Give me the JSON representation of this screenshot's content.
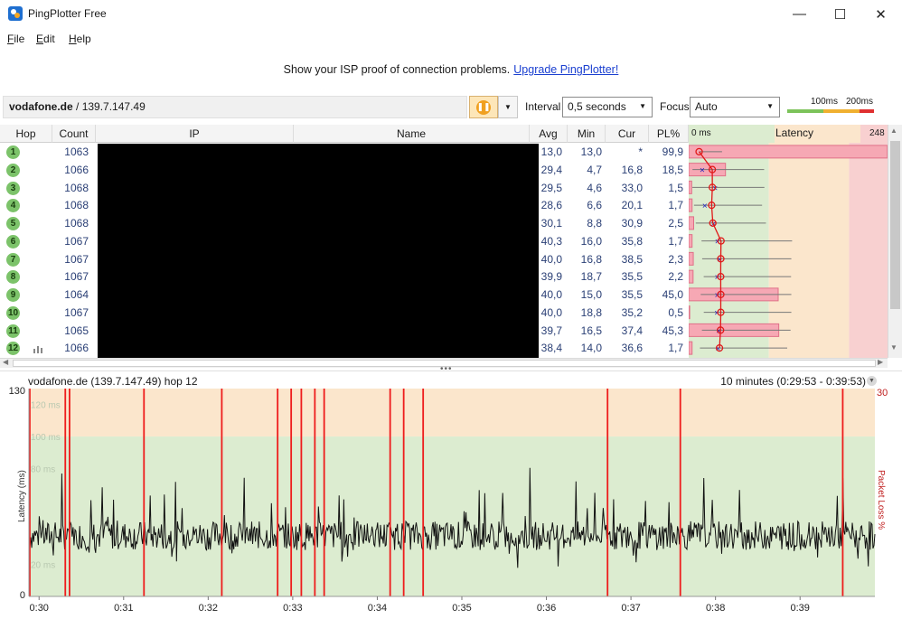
{
  "window": {
    "title": "PingPlotter Free",
    "minimize": "—",
    "maximize": "☐",
    "close": "✕"
  },
  "menu": [
    {
      "label": "File",
      "ul": "F",
      "rest": "ile"
    },
    {
      "label": "Edit",
      "ul": "E",
      "rest": "dit"
    },
    {
      "label": "Help",
      "ul": "H",
      "rest": "elp"
    }
  ],
  "promo": {
    "text": "Show your ISP proof of connection problems.",
    "link": "Upgrade PingPlotter!"
  },
  "toolbar": {
    "target_host": "vodafone.de",
    "target_ip": " / 139.7.147.49",
    "interval_label": "Interval",
    "interval_value": "0,5 seconds",
    "focus_label": "Focus",
    "focus_value": "Auto",
    "scale_100": "100ms",
    "scale_200": "200ms"
  },
  "table": {
    "headers": {
      "hop": "Hop",
      "count": "Count",
      "ip": "IP",
      "name": "Name",
      "avg": "Avg",
      "min": "Min",
      "cur": "Cur",
      "pl": "PL%",
      "latency": "Latency",
      "latency_start": "0 ms",
      "latency_end": "248"
    },
    "rows": [
      {
        "hop": "1",
        "count": "1063",
        "avg": "13,0",
        "min": "13,0",
        "cur": "*",
        "pl": "99,9"
      },
      {
        "hop": "2",
        "count": "1066",
        "avg": "29,4",
        "min": "4,7",
        "cur": "16,8",
        "pl": "18,5"
      },
      {
        "hop": "3",
        "count": "1068",
        "avg": "29,5",
        "min": "4,6",
        "cur": "33,0",
        "pl": "1,5"
      },
      {
        "hop": "4",
        "count": "1068",
        "avg": "28,6",
        "min": "6,6",
        "cur": "20,1",
        "pl": "1,7"
      },
      {
        "hop": "5",
        "count": "1068",
        "avg": "30,1",
        "min": "8,8",
        "cur": "30,9",
        "pl": "2,5"
      },
      {
        "hop": "6",
        "count": "1067",
        "avg": "40,3",
        "min": "16,0",
        "cur": "35,8",
        "pl": "1,7"
      },
      {
        "hop": "7",
        "count": "1067",
        "avg": "40,0",
        "min": "16,8",
        "cur": "38,5",
        "pl": "2,3"
      },
      {
        "hop": "8",
        "count": "1067",
        "avg": "39,9",
        "min": "18,7",
        "cur": "35,5",
        "pl": "2,2"
      },
      {
        "hop": "9",
        "count": "1064",
        "avg": "40,0",
        "min": "15,0",
        "cur": "35,5",
        "pl": "45,0"
      },
      {
        "hop": "10",
        "count": "1067",
        "avg": "40,0",
        "min": "18,8",
        "cur": "35,2",
        "pl": "0,5"
      },
      {
        "hop": "11",
        "count": "1065",
        "avg": "39,7",
        "min": "16,5",
        "cur": "37,4",
        "pl": "45,3"
      },
      {
        "hop": "12",
        "count": "1066",
        "avg": "38,4",
        "min": "14,0",
        "cur": "36,6",
        "pl": "1,7"
      }
    ]
  },
  "graph": {
    "title": "vodafone.de (139.7.147.49) hop 12",
    "range": "10 minutes (0:29:53 - 0:39:53)",
    "y_max": "130",
    "y_min": "0",
    "pl_max": "30",
    "y_label": "Latency (ms)",
    "pl_label": "Packet Loss %",
    "band_labels": [
      "120 ms",
      "100 ms",
      "80 ms",
      "20 ms"
    ],
    "x_ticks": [
      "0:30",
      "0:31",
      "0:32",
      "0:33",
      "0:34",
      "0:35",
      "0:36",
      "0:37",
      "0:38",
      "0:39"
    ],
    "loss_marks_min": [
      0.01,
      0.43,
      0.48,
      1.36,
      2.28,
      2.94,
      3.1,
      3.22,
      3.38,
      3.49,
      4.27,
      4.43,
      4.66,
      6.84,
      7.7,
      9.62
    ]
  },
  "colors": {
    "green_zone": "#dcecd0",
    "yellow_zone": "#fbe6cc",
    "red_zone": "#f8d0d0",
    "loss_line": "#ee1c1c",
    "latency_line": "#111111"
  }
}
